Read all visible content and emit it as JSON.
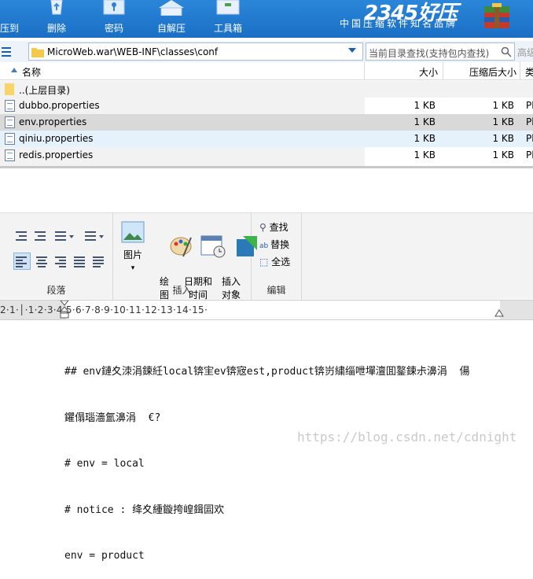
{
  "app": {
    "brand": "2345好压",
    "tagline": "中国压缩软件知名品牌"
  },
  "toolbar": {
    "buttons": [
      {
        "label": "压到",
        "icon": "archive-icon"
      },
      {
        "label": "删除",
        "icon": "recycle-bin-icon"
      },
      {
        "label": "密码",
        "icon": "lock-icon"
      },
      {
        "label": "自解压",
        "icon": "self-extract-icon"
      },
      {
        "label": "工具箱",
        "icon": "toolbox-icon"
      }
    ]
  },
  "address": {
    "path": "MicroWeb.war\\WEB-INF\\classes\\conf",
    "search_placeholder": "当前目录查找(支持包内查找)",
    "advanced": "高级"
  },
  "file_list": {
    "columns": {
      "name": "名称",
      "size": "大小",
      "compressed": "压缩后大小",
      "type": "类"
    },
    "parent": "..(上层目录)",
    "rows": [
      {
        "name": "dubbo.properties",
        "size": "1 KB",
        "compressed": "1 KB",
        "type": "Pl"
      },
      {
        "name": "env.properties",
        "size": "1 KB",
        "compressed": "1 KB",
        "type": "Pl"
      },
      {
        "name": "qiniu.properties",
        "size": "1 KB",
        "compressed": "1 KB",
        "type": "Pl"
      },
      {
        "name": "redis.properties",
        "size": "1 KB",
        "compressed": "1 KB",
        "type": "Pl"
      }
    ]
  },
  "ribbon": {
    "paragraph_label": "段落",
    "insert": {
      "label": "插入",
      "picture": "图片",
      "draw": "绘\n图",
      "datetime": "日期和\n时间",
      "object": "插入\n对象"
    },
    "edit": {
      "label": "编辑",
      "find": "查找",
      "replace": "替换",
      "select_all": "全选"
    }
  },
  "ruler": {
    "ticks": "2·1·│·1·2·3·4·5·6·7·8·9·10·11·12·13·14·15·"
  },
  "document": {
    "lines": [
      "## env鏈夊洓涓鍊紝local锛宔ev锛宼est,product锛岃繍缁呭墠澶囬鐜鍊尗濞涓  偒",
      "鑺傝瑙濇氳濞涓  €?",
      "# env = local",
      "# notice : 绛夊緟鏇挎崲鍓囩欢",
      "env = product"
    ]
  },
  "watermark": "https://blog.csdn.net/cdnight"
}
